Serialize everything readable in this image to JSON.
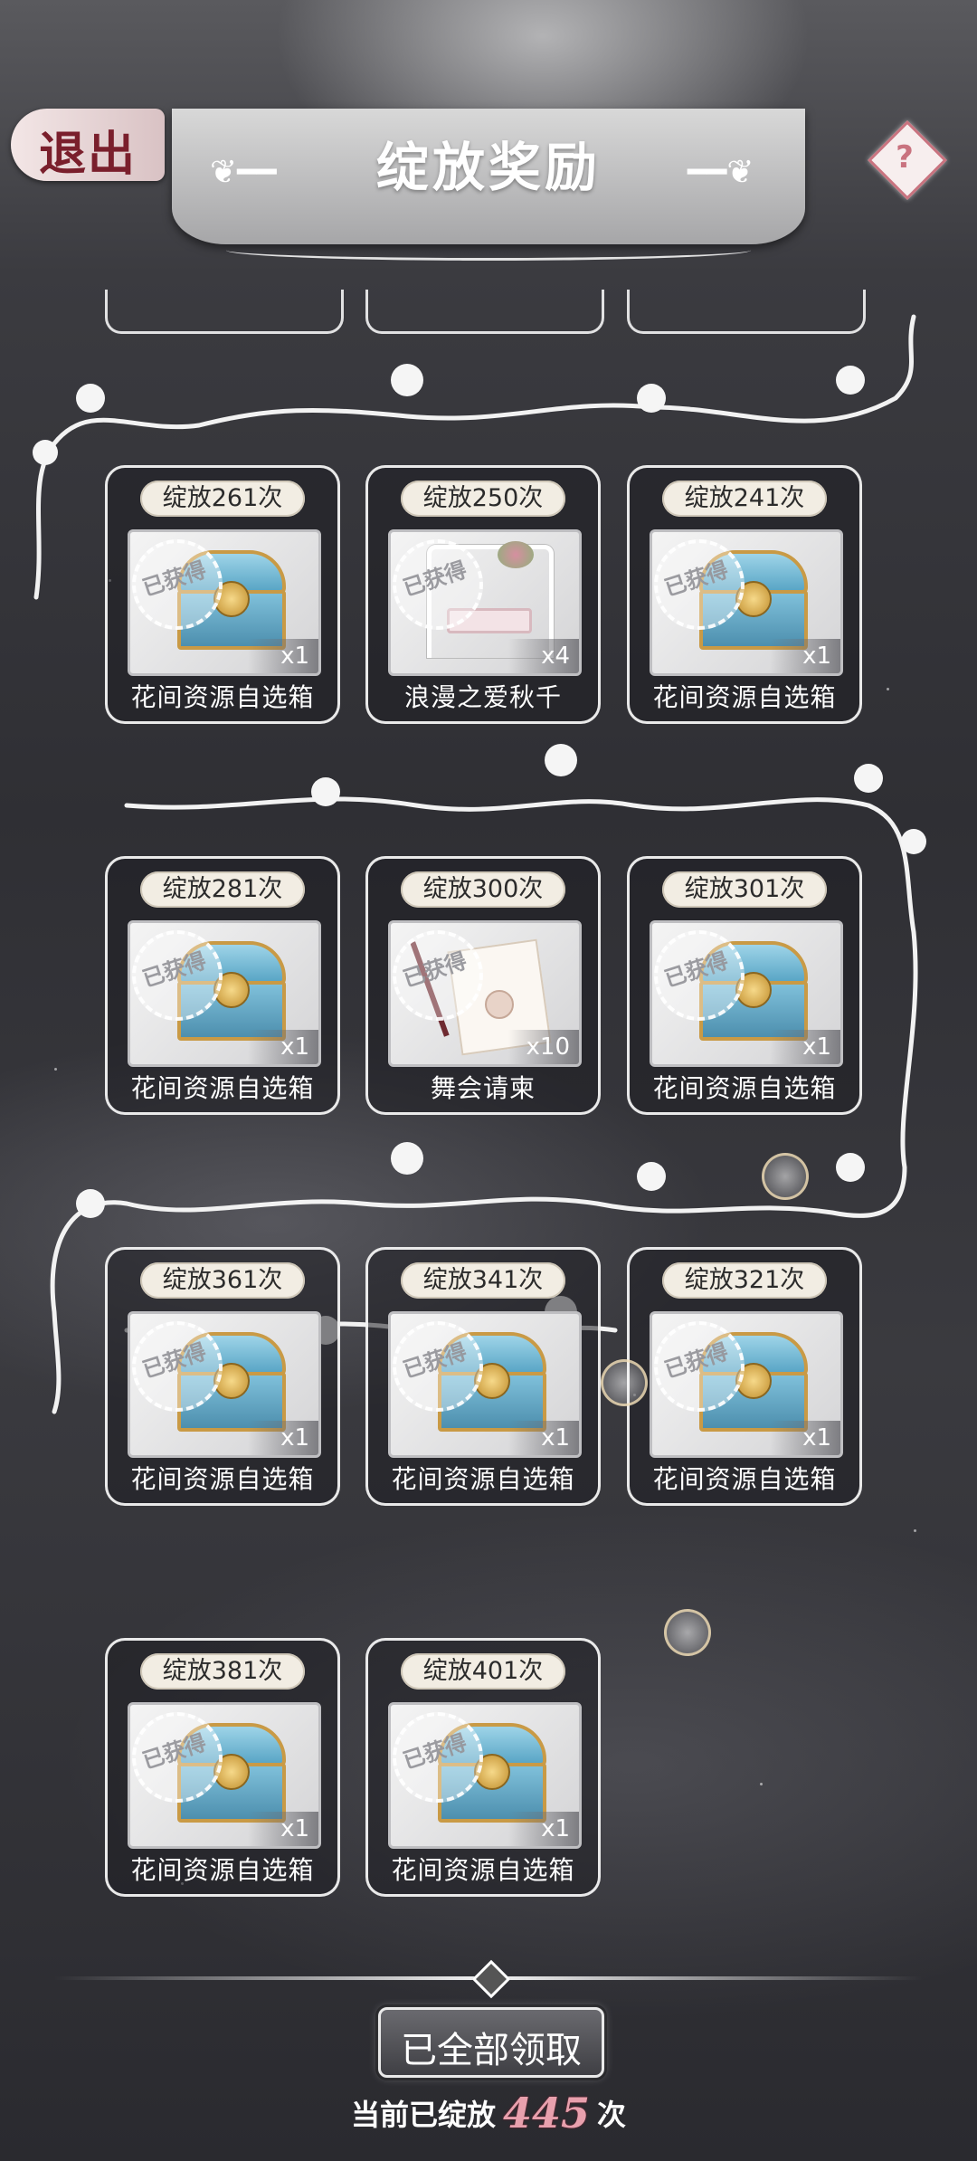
{
  "header": {
    "exit_label": "退出",
    "title": "绽放奖励",
    "help_label": "?"
  },
  "stamp_text": "已获得",
  "rows": [
    [
      {
        "count_label": "绽放261次",
        "item": "chest",
        "qty": "x1",
        "name": "花间资源自选箱"
      },
      {
        "count_label": "绽放250次",
        "item": "swing",
        "qty": "x4",
        "name": "浪漫之爱秋千"
      },
      {
        "count_label": "绽放241次",
        "item": "chest",
        "qty": "x1",
        "name": "花间资源自选箱"
      }
    ],
    [
      {
        "count_label": "绽放281次",
        "item": "chest",
        "qty": "x1",
        "name": "花间资源自选箱"
      },
      {
        "count_label": "绽放300次",
        "item": "letter",
        "qty": "x10",
        "name": "舞会请柬"
      },
      {
        "count_label": "绽放301次",
        "item": "chest",
        "qty": "x1",
        "name": "花间资源自选箱"
      }
    ],
    [
      {
        "count_label": "绽放361次",
        "item": "chest",
        "qty": "x1",
        "name": "花间资源自选箱"
      },
      {
        "count_label": "绽放341次",
        "item": "chest",
        "qty": "x1",
        "name": "花间资源自选箱"
      },
      {
        "count_label": "绽放321次",
        "item": "chest",
        "qty": "x1",
        "name": "花间资源自选箱"
      }
    ],
    [
      {
        "count_label": "绽放381次",
        "item": "chest",
        "qty": "x1",
        "name": "花间资源自选箱"
      },
      {
        "count_label": "绽放401次",
        "item": "chest",
        "qty": "x1",
        "name": "花间资源自选箱"
      }
    ]
  ],
  "footer": {
    "claim_all_label": "已全部领取",
    "status_prefix": "当前已绽放",
    "bloom_count": "445",
    "status_suffix": "次"
  },
  "colors": {
    "accent_pink": "#e8a0ad",
    "exit_red": "#7a1f2c",
    "card_border": "#ffffff",
    "chest_blue": "#7fc0da",
    "chest_gold": "#c99a45"
  }
}
